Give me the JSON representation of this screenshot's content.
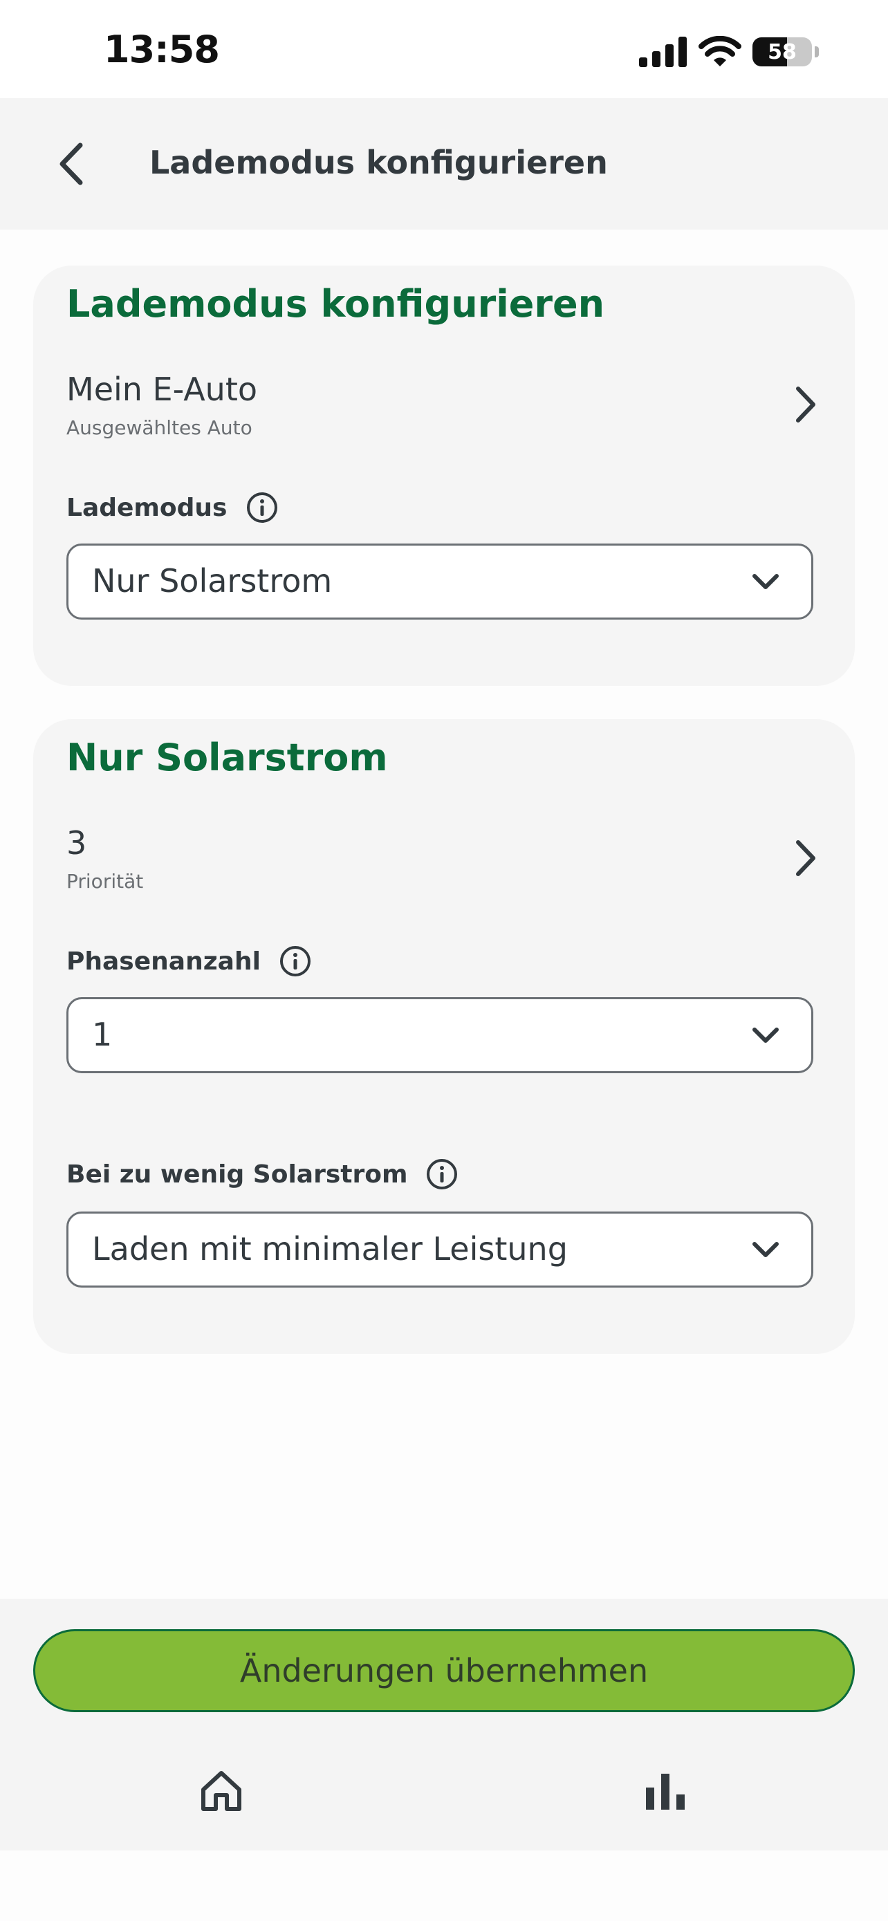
{
  "status_bar": {
    "time": "13:58",
    "battery_percent": "58",
    "battery_level": 0.58,
    "icons": [
      "cellular-signal-icon",
      "wifi-icon",
      "battery-icon"
    ]
  },
  "header": {
    "back_icon": "chevron-left-icon",
    "title": "Lademodus konfigurieren"
  },
  "config_card": {
    "title": "Lademodus konfigurieren",
    "car": {
      "value": "Mein E-Auto",
      "caption": "Ausgewähltes Auto"
    },
    "mode_label": "Lademodus",
    "mode_selected": "Nur Solarstrom"
  },
  "mode_card": {
    "title": "Nur Solarstrom",
    "priority": {
      "value": "3",
      "caption": "Priorität"
    },
    "phases_label": "Phasenanzahl",
    "phases_selected": "1",
    "low_solar_label": "Bei zu wenig Solarstrom",
    "low_solar_selected": "Laden mit minimaler Leistung"
  },
  "apply_button": "Änderungen übernehmen",
  "tab_bar": {
    "tabs": [
      {
        "icon": "home-icon"
      },
      {
        "icon": "bar-chart-icon"
      }
    ]
  },
  "colors": {
    "accent_green": "#0b6b3b",
    "button_green": "#84bb37",
    "text": "#333a3f",
    "card_bg": "#f5f5f5"
  }
}
